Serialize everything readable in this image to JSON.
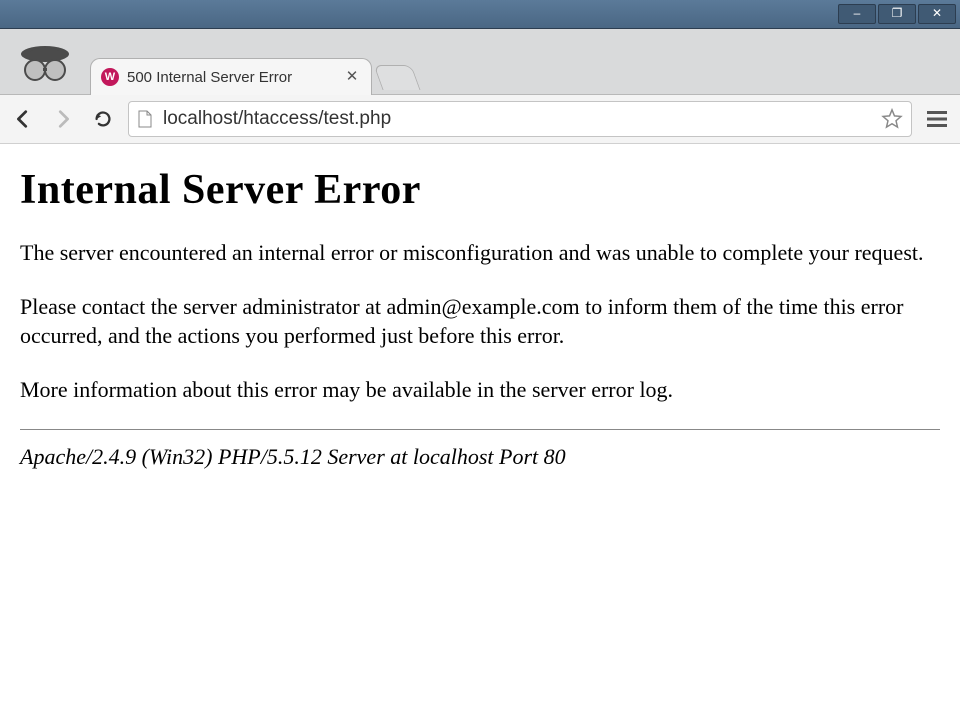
{
  "window_controls": {
    "minimize": "–",
    "maximize": "❐",
    "close": "✕"
  },
  "tab": {
    "favicon_letter": "W",
    "title": "500 Internal Server Error",
    "close": "✕"
  },
  "toolbar": {
    "url": "localhost/htaccess/test.php"
  },
  "page": {
    "heading": "Internal Server Error",
    "p1": "The server encountered an internal error or misconfiguration and was unable to complete your request.",
    "p2": "Please contact the server administrator at admin@example.com to inform them of the time this error occurred, and the actions you performed just before this error.",
    "p3": "More information about this error may be available in the server error log.",
    "signature": "Apache/2.4.9 (Win32) PHP/5.5.12 Server at localhost Port 80"
  }
}
